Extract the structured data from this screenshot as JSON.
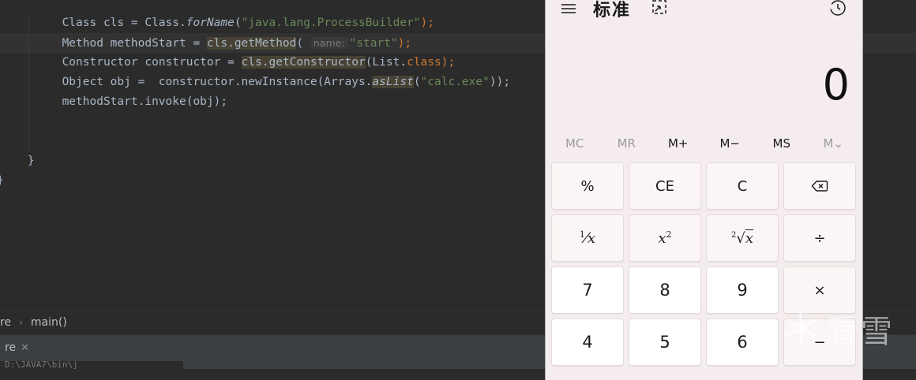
{
  "editor": {
    "code_lines": [
      {
        "parts": [
          {
            "t": "Class cls = Class.",
            "c": ""
          },
          {
            "t": "forName",
            "c": "it"
          },
          {
            "t": "(",
            "c": ""
          },
          {
            "t": "\"java.lang.ProcessBuilder\"",
            "c": "str"
          },
          {
            "t": ");",
            "c": "kw"
          }
        ]
      },
      {
        "parts": [
          {
            "t": "Method methodStart = ",
            "c": ""
          },
          {
            "t": "cls.getMethod",
            "c": "hl"
          },
          {
            "t": "( ",
            "c": ""
          },
          {
            "t": "name:",
            "c": "hint"
          },
          {
            "t": "\"start\"",
            "c": "str"
          },
          {
            "t": ");",
            "c": "kw"
          }
        ]
      },
      {
        "parts": [
          {
            "t": "Constructor constructor = ",
            "c": ""
          },
          {
            "t": "cls.getConstructor",
            "c": "hl"
          },
          {
            "t": "(List.",
            "c": ""
          },
          {
            "t": "class",
            "c": "kw"
          },
          {
            "t": ");",
            "c": "kw"
          }
        ]
      },
      {
        "parts": [
          {
            "t": "Object obj =  constructor.newInstance(Arrays.",
            "c": ""
          },
          {
            "t": "asList",
            "c": "it hl"
          },
          {
            "t": "(",
            "c": ""
          },
          {
            "t": "\"calc.exe\"",
            "c": "str"
          },
          {
            "t": "));",
            "c": ""
          }
        ]
      },
      {
        "parts": [
          {
            "t": "methodStart.invoke(obj);",
            "c": ""
          }
        ]
      }
    ],
    "close_brace_inner": "}",
    "close_brace_outer": "}"
  },
  "breadcrumb": {
    "items": [
      "re",
      "main()"
    ]
  },
  "run_panel": {
    "tab_label": "re",
    "close_glyph": "✕",
    "console_text": "D:\\JAVA7\\bin\\j"
  },
  "calculator": {
    "mode_title": "标准",
    "display_value": "0",
    "memory_buttons": [
      {
        "label": "MC",
        "enabled": false
      },
      {
        "label": "MR",
        "enabled": false
      },
      {
        "label": "M+",
        "enabled": true
      },
      {
        "label": "M−",
        "enabled": true
      },
      {
        "label": "MS",
        "enabled": true
      },
      {
        "label": "M⌄",
        "enabled": false
      }
    ],
    "keys": {
      "percent": "%",
      "ce": "CE",
      "c": "C",
      "divide": "÷",
      "multiply": "×",
      "minus": "−",
      "seven": "7",
      "eight": "8",
      "nine": "9",
      "four": "4",
      "five": "5",
      "six": "6"
    },
    "icons": {
      "menu": "hamburger-menu-icon",
      "keep_on_top": "keep-on-top-icon",
      "history": "history-icon",
      "backspace": "backspace-icon"
    }
  },
  "watermark": {
    "text": "看雪"
  }
}
